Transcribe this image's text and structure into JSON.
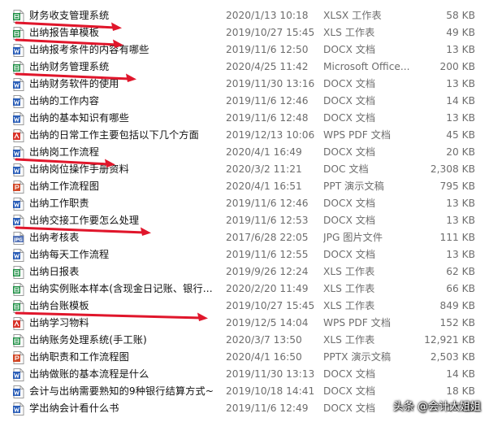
{
  "colors": {
    "xls": "#1e8f44",
    "doc": "#2b5eb8",
    "pdf": "#d9342b",
    "ppt": "#d24726",
    "jpg": "#5574b8",
    "arrow": "#e0162b"
  },
  "files": [
    {
      "name": "财务收支管理系统",
      "date": "2020/1/13 10:18",
      "type": "XLSX 工作表",
      "size": "58 KB",
      "icon": "xls-file-icon",
      "kind": "xls"
    },
    {
      "name": "出纳报告单模板",
      "date": "2019/10/27 15:45",
      "type": "XLS 工作表",
      "size": "49 KB",
      "icon": "xls-file-icon",
      "kind": "xls"
    },
    {
      "name": "出纳报考条件的内容有哪些",
      "date": "2019/11/6 12:50",
      "type": "DOCX 文档",
      "size": "13 KB",
      "icon": "word-file-icon",
      "kind": "doc"
    },
    {
      "name": "出纳财务管理系统",
      "date": "2020/4/25 11:42",
      "type": "Microsoft Office...",
      "size": "200 KB",
      "icon": "xls-file-icon",
      "kind": "xls"
    },
    {
      "name": "出纳财务软件的使用",
      "date": "2019/11/30 13:16",
      "type": "DOCX 文档",
      "size": "13 KB",
      "icon": "word-file-icon",
      "kind": "doc"
    },
    {
      "name": "出纳的工作内容",
      "date": "2019/11/6 12:46",
      "type": "DOCX 文档",
      "size": "14 KB",
      "icon": "word-file-icon",
      "kind": "doc"
    },
    {
      "name": "出纳的基本知识有哪些",
      "date": "2019/11/6 12:48",
      "type": "DOCX 文档",
      "size": "13 KB",
      "icon": "word-file-icon",
      "kind": "doc"
    },
    {
      "name": "出纳的日常工作主要包括以下几个方面",
      "date": "2019/12/13 10:06",
      "type": "WPS PDF 文档",
      "size": "45 KB",
      "icon": "pdf-file-icon",
      "kind": "pdf"
    },
    {
      "name": "出纳岗工作流程",
      "date": "2020/4/1 16:49",
      "type": "DOCX 文档",
      "size": "20 KB",
      "icon": "word-file-icon",
      "kind": "doc"
    },
    {
      "name": "出纳岗位操作手册资料",
      "date": "2020/3/2 11:21",
      "type": "DOC 文档",
      "size": "2,308 KB",
      "icon": "word-file-icon",
      "kind": "doc"
    },
    {
      "name": "出纳工作流程图",
      "date": "2020/4/1 16:51",
      "type": "PPT 演示文稿",
      "size": "795 KB",
      "icon": "ppt-file-icon",
      "kind": "ppt"
    },
    {
      "name": "出纳工作职责",
      "date": "2019/11/6 12:46",
      "type": "DOCX 文档",
      "size": "13 KB",
      "icon": "word-file-icon",
      "kind": "doc"
    },
    {
      "name": "出纳交接工作要怎么处理",
      "date": "2019/11/6 12:53",
      "type": "DOCX 文档",
      "size": "13 KB",
      "icon": "word-file-icon",
      "kind": "doc"
    },
    {
      "name": "出纳考核表",
      "date": "2017/6/28 22:05",
      "type": "JPG 图片文件",
      "size": "111 KB",
      "icon": "jpg-file-icon",
      "kind": "jpg"
    },
    {
      "name": "出纳每天工作流程",
      "date": "2019/11/6 12:55",
      "type": "DOCX 文档",
      "size": "13 KB",
      "icon": "word-file-icon",
      "kind": "doc"
    },
    {
      "name": "出纳日报表",
      "date": "2019/9/26 12:24",
      "type": "XLS 工作表",
      "size": "62 KB",
      "icon": "xls-file-icon",
      "kind": "xls"
    },
    {
      "name": "出纳实例账本样本(含现金日记账、银行...",
      "date": "2020/2/20 11:49",
      "type": "XLS 工作表",
      "size": "66 KB",
      "icon": "xls-file-icon",
      "kind": "xls"
    },
    {
      "name": "出纳台账模板",
      "date": "2019/10/27 15:45",
      "type": "XLS 工作表",
      "size": "849 KB",
      "icon": "xls-file-icon",
      "kind": "xls"
    },
    {
      "name": "出纳学习物料",
      "date": "2019/12/5 14:04",
      "type": "WPS PDF 文档",
      "size": "152 KB",
      "icon": "pdf-file-icon",
      "kind": "pdf"
    },
    {
      "name": "出纳账务处理系统(手工账)",
      "date": "2020/3/7 13:50",
      "type": "XLS 工作表",
      "size": "12,921 KB",
      "icon": "xls-file-icon",
      "kind": "xls"
    },
    {
      "name": "出纳职责和工作流程图",
      "date": "2020/4/1 16:50",
      "type": "PPTX 演示文稿",
      "size": "2,503 KB",
      "icon": "ppt-file-icon",
      "kind": "ppt"
    },
    {
      "name": "出纳做账的基本流程是什么",
      "date": "2019/11/30 13:13",
      "type": "DOCX 文档",
      "size": "14 KB",
      "icon": "word-file-icon",
      "kind": "doc"
    },
    {
      "name": "会计与出纳需要熟知的9种银行结算方式~",
      "date": "2019/10/18 14:41",
      "type": "DOCX 文档",
      "size": "18 KB",
      "icon": "word-file-icon",
      "kind": "doc"
    },
    {
      "name": "学出纳会计看什么书",
      "date": "2019/11/6 12:49",
      "type": "DOCX 文档",
      "size": "13 KB",
      "icon": "word-file-icon",
      "kind": "doc"
    }
  ],
  "highlighted_rows": [
    0,
    1,
    3,
    8,
    12,
    17
  ],
  "watermark": "头条 @会计大姐姐"
}
